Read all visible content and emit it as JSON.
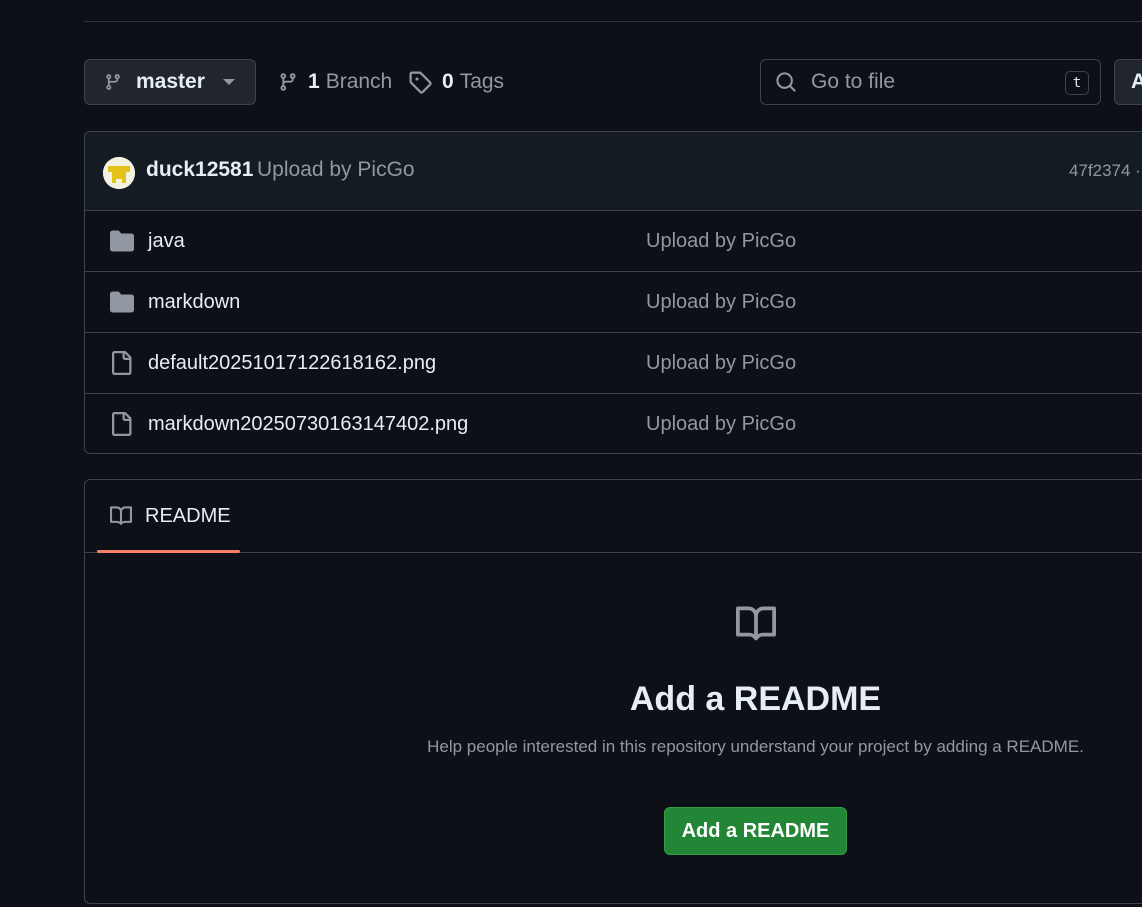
{
  "branch_selector": {
    "name": "master"
  },
  "branches": {
    "count": "1",
    "label": "Branch"
  },
  "tags": {
    "count": "0",
    "label": "Tags"
  },
  "search": {
    "placeholder": "Go to file",
    "shortcut": "t"
  },
  "add_file": {
    "label": "A"
  },
  "commit": {
    "author": "duck12581",
    "message": "Upload by PicGo",
    "hash": "47f2374 ·"
  },
  "files": [
    {
      "name": "java",
      "type": "folder",
      "commit": "Upload by PicGo"
    },
    {
      "name": "markdown",
      "type": "folder",
      "commit": "Upload by PicGo"
    },
    {
      "name": "default20251017122618162.png",
      "type": "file",
      "commit": "Upload by PicGo"
    },
    {
      "name": "markdown20250730163147402.png",
      "type": "file",
      "commit": "Upload by PicGo"
    }
  ],
  "readme": {
    "tab_label": "README",
    "empty_title": "Add a README",
    "empty_description": "Help people interested in this repository understand your project by adding a README.",
    "button_label": "Add a README"
  },
  "colors": {
    "background": "#0d1117",
    "accent_underline": "#f78166",
    "primary_button": "#238636"
  }
}
